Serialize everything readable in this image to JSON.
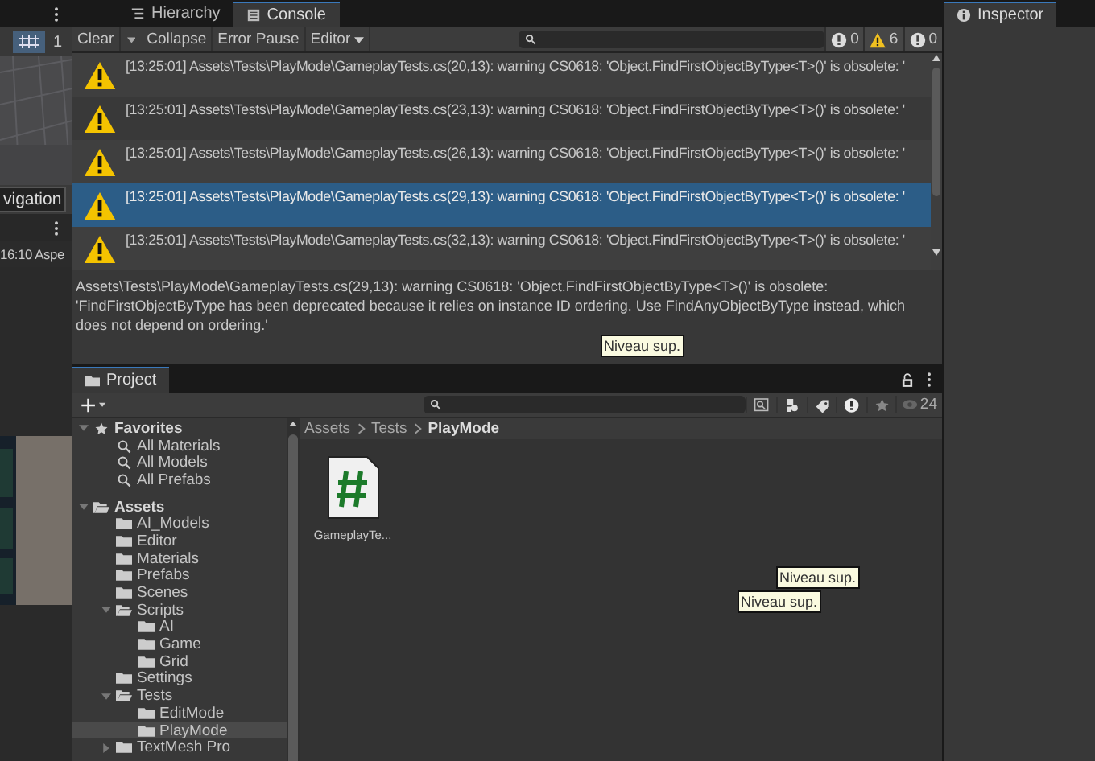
{
  "left_strip": {
    "toolbar_value": "1",
    "field_value": "vigation",
    "aspect": "16:10 Aspe"
  },
  "tabs": [
    {
      "label": "Hierarchy",
      "selected": false
    },
    {
      "label": "Console",
      "selected": true
    }
  ],
  "console": {
    "toolbar": [
      {
        "label": "Clear",
        "kind": "split"
      },
      {
        "label": "Collapse",
        "kind": "button"
      },
      {
        "label": "Error Pause",
        "kind": "button"
      },
      {
        "label": "Editor",
        "kind": "dropdown"
      }
    ],
    "counts": {
      "errors": "0",
      "warnings": "6",
      "infos": "0"
    },
    "rows": [
      {
        "text": "[13:25:01] Assets\\Tests\\PlayMode\\GameplayTests.cs(20,13): warning CS0618: 'Object.FindFirstObjectByType<T>()' is obsolete: '",
        "selected": false
      },
      {
        "text": "[13:25:01] Assets\\Tests\\PlayMode\\GameplayTests.cs(23,13): warning CS0618: 'Object.FindFirstObjectByType<T>()' is obsolete: '",
        "selected": false
      },
      {
        "text": "[13:25:01] Assets\\Tests\\PlayMode\\GameplayTests.cs(26,13): warning CS0618: 'Object.FindFirstObjectByType<T>()' is obsolete: '",
        "selected": false
      },
      {
        "text": "[13:25:01] Assets\\Tests\\PlayMode\\GameplayTests.cs(29,13): warning CS0618: 'Object.FindFirstObjectByType<T>()' is obsolete: '",
        "selected": true
      },
      {
        "text": "[13:25:01] Assets\\Tests\\PlayMode\\GameplayTests.cs(32,13): warning CS0618: 'Object.FindFirstObjectByType<T>()' is obsolete: '",
        "selected": false
      }
    ],
    "detail": "Assets\\Tests\\PlayMode\\GameplayTests.cs(29,13): warning CS0618: 'Object.FindFirstObjectByType<T>()' is obsolete: 'FindFirstObjectByType has been deprecated because it relies on instance ID ordering. Use FindAnyObjectByType instead, which does not depend on ordering.'",
    "tooltip": "Niveau sup."
  },
  "project": {
    "tab": "Project",
    "visible_count": "24",
    "tree": [
      {
        "label": "Favorites",
        "kind": "favorites",
        "expanded": true,
        "selected": false,
        "children": [
          {
            "label": "All Materials",
            "kind": "search",
            "selected": false
          },
          {
            "label": "All Models",
            "kind": "search",
            "selected": false
          },
          {
            "label": "All Prefabs",
            "kind": "search",
            "selected": false
          }
        ]
      },
      {
        "label": "Assets",
        "kind": "folder",
        "expanded": true,
        "selected": false,
        "children": [
          {
            "label": "AI_Models",
            "kind": "folder",
            "selected": false
          },
          {
            "label": "Editor",
            "kind": "folder",
            "selected": false
          },
          {
            "label": "Materials",
            "kind": "folder",
            "selected": false
          },
          {
            "label": "Prefabs",
            "kind": "folder",
            "selected": false
          },
          {
            "label": "Scenes",
            "kind": "folder",
            "selected": false
          },
          {
            "label": "Scripts",
            "kind": "folder",
            "expanded": true,
            "selected": false,
            "children": [
              {
                "label": "AI",
                "kind": "folder",
                "selected": false
              },
              {
                "label": "Game",
                "kind": "folder",
                "selected": false
              },
              {
                "label": "Grid",
                "kind": "folder",
                "selected": false
              }
            ]
          },
          {
            "label": "Settings",
            "kind": "folder",
            "selected": false
          },
          {
            "label": "Tests",
            "kind": "folder",
            "expanded": true,
            "selected": false,
            "children": [
              {
                "label": "EditMode",
                "kind": "folder",
                "selected": false
              },
              {
                "label": "PlayMode",
                "kind": "folder",
                "selected": true
              }
            ]
          },
          {
            "label": "TextMesh Pro",
            "kind": "folder",
            "expanded": false,
            "selected": false
          }
        ]
      }
    ],
    "breadcrumb": [
      "Assets",
      "Tests",
      "PlayMode"
    ],
    "files": [
      {
        "name": "GameplayTe..."
      }
    ],
    "tooltips": [
      "Niveau sup.",
      "Niveau sup."
    ]
  },
  "inspector": {
    "tab": "Inspector"
  }
}
